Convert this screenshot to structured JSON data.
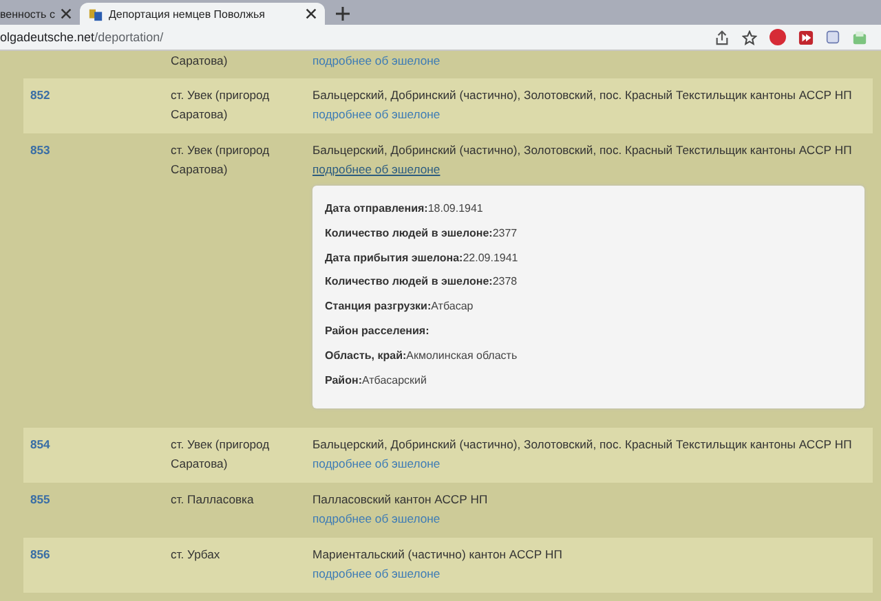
{
  "browser": {
    "tabs": [
      {
        "title": "венность с",
        "selected": false
      },
      {
        "title": "Депортация немцев Поволжья",
        "selected": true
      }
    ],
    "url_host": "olgadeutsche.net",
    "url_path": "/deportation/"
  },
  "rows": [
    {
      "station": [
        "Саратова)"
      ],
      "link": "подробнее об эшелоне",
      "striped": false,
      "expanded": false
    },
    {
      "number": "852",
      "station": [
        "ст. Увек (пригород",
        "Саратова)"
      ],
      "cantons": "Бальцерский, Добринский (частично), Золотовский, пос. Красный Текстильщик кантоны АССР НП",
      "link": "подробнее об эшелоне",
      "striped": true,
      "expanded": false
    },
    {
      "number": "853",
      "station": [
        "ст. Увек (пригород",
        "Саратова)"
      ],
      "cantons": "Бальцерский, Добринский (частично), Золотовский, пос. Красный Текстильщик кантоны АССР НП",
      "link": "подробнее об эшелоне",
      "striped": false,
      "expanded": true,
      "details": [
        {
          "label": "Дата отправления:",
          "value": "18.09.1941"
        },
        {
          "label": "Количество людей в эшелоне:",
          "value": "2377"
        },
        {
          "label": "Дата прибытия эшелона:",
          "value": "22.09.1941"
        },
        {
          "label": "Количество людей в эшелоне:",
          "value": "2378"
        },
        {
          "label": "Станция разгрузки:",
          "value": "Атбасар"
        },
        {
          "label": "Район расселения:"
        },
        {
          "label": "Область, край:",
          "value": "Акмолинская область"
        },
        {
          "label": "Район:",
          "value": "Атбасарский"
        }
      ]
    },
    {
      "number": "854",
      "station": [
        "ст. Увек (пригород",
        "Саратова)"
      ],
      "cantons": "Бальцерский, Добринский (частично), Золотовский, пос. Красный Текстильщик кантоны АССР НП",
      "link": "подробнее об эшелоне",
      "striped": true,
      "expanded": false
    },
    {
      "number": "855",
      "station": [
        "ст. Палласовка"
      ],
      "cantons": "Палласовский кантон АССР НП",
      "link": "подробнее об эшелоне",
      "striped": false,
      "expanded": false
    },
    {
      "number": "856",
      "station": [
        "ст. Урбах"
      ],
      "cantons": "Мариентальский (частично) кантон АССР НП",
      "link": "подробнее об эшелоне",
      "striped": true,
      "expanded": false
    }
  ]
}
